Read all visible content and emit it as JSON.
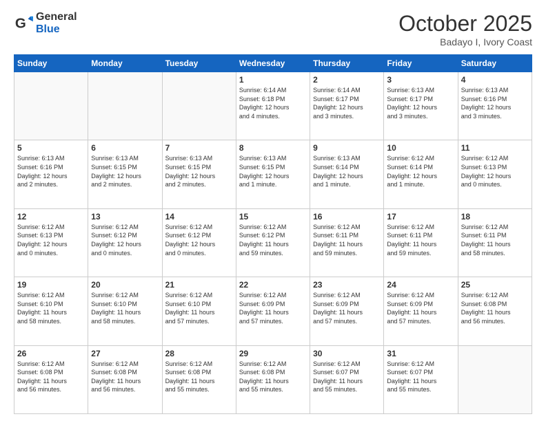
{
  "header": {
    "logo_line1": "General",
    "logo_line2": "Blue",
    "month": "October 2025",
    "location": "Badayo I, Ivory Coast"
  },
  "weekdays": [
    "Sunday",
    "Monday",
    "Tuesday",
    "Wednesday",
    "Thursday",
    "Friday",
    "Saturday"
  ],
  "weeks": [
    [
      {
        "day": "",
        "info": ""
      },
      {
        "day": "",
        "info": ""
      },
      {
        "day": "",
        "info": ""
      },
      {
        "day": "1",
        "info": "Sunrise: 6:14 AM\nSunset: 6:18 PM\nDaylight: 12 hours\nand 4 minutes."
      },
      {
        "day": "2",
        "info": "Sunrise: 6:14 AM\nSunset: 6:17 PM\nDaylight: 12 hours\nand 3 minutes."
      },
      {
        "day": "3",
        "info": "Sunrise: 6:13 AM\nSunset: 6:17 PM\nDaylight: 12 hours\nand 3 minutes."
      },
      {
        "day": "4",
        "info": "Sunrise: 6:13 AM\nSunset: 6:16 PM\nDaylight: 12 hours\nand 3 minutes."
      }
    ],
    [
      {
        "day": "5",
        "info": "Sunrise: 6:13 AM\nSunset: 6:16 PM\nDaylight: 12 hours\nand 2 minutes."
      },
      {
        "day": "6",
        "info": "Sunrise: 6:13 AM\nSunset: 6:15 PM\nDaylight: 12 hours\nand 2 minutes."
      },
      {
        "day": "7",
        "info": "Sunrise: 6:13 AM\nSunset: 6:15 PM\nDaylight: 12 hours\nand 2 minutes."
      },
      {
        "day": "8",
        "info": "Sunrise: 6:13 AM\nSunset: 6:15 PM\nDaylight: 12 hours\nand 1 minute."
      },
      {
        "day": "9",
        "info": "Sunrise: 6:13 AM\nSunset: 6:14 PM\nDaylight: 12 hours\nand 1 minute."
      },
      {
        "day": "10",
        "info": "Sunrise: 6:12 AM\nSunset: 6:14 PM\nDaylight: 12 hours\nand 1 minute."
      },
      {
        "day": "11",
        "info": "Sunrise: 6:12 AM\nSunset: 6:13 PM\nDaylight: 12 hours\nand 0 minutes."
      }
    ],
    [
      {
        "day": "12",
        "info": "Sunrise: 6:12 AM\nSunset: 6:13 PM\nDaylight: 12 hours\nand 0 minutes."
      },
      {
        "day": "13",
        "info": "Sunrise: 6:12 AM\nSunset: 6:12 PM\nDaylight: 12 hours\nand 0 minutes."
      },
      {
        "day": "14",
        "info": "Sunrise: 6:12 AM\nSunset: 6:12 PM\nDaylight: 12 hours\nand 0 minutes."
      },
      {
        "day": "15",
        "info": "Sunrise: 6:12 AM\nSunset: 6:12 PM\nDaylight: 11 hours\nand 59 minutes."
      },
      {
        "day": "16",
        "info": "Sunrise: 6:12 AM\nSunset: 6:11 PM\nDaylight: 11 hours\nand 59 minutes."
      },
      {
        "day": "17",
        "info": "Sunrise: 6:12 AM\nSunset: 6:11 PM\nDaylight: 11 hours\nand 59 minutes."
      },
      {
        "day": "18",
        "info": "Sunrise: 6:12 AM\nSunset: 6:11 PM\nDaylight: 11 hours\nand 58 minutes."
      }
    ],
    [
      {
        "day": "19",
        "info": "Sunrise: 6:12 AM\nSunset: 6:10 PM\nDaylight: 11 hours\nand 58 minutes."
      },
      {
        "day": "20",
        "info": "Sunrise: 6:12 AM\nSunset: 6:10 PM\nDaylight: 11 hours\nand 58 minutes."
      },
      {
        "day": "21",
        "info": "Sunrise: 6:12 AM\nSunset: 6:10 PM\nDaylight: 11 hours\nand 57 minutes."
      },
      {
        "day": "22",
        "info": "Sunrise: 6:12 AM\nSunset: 6:09 PM\nDaylight: 11 hours\nand 57 minutes."
      },
      {
        "day": "23",
        "info": "Sunrise: 6:12 AM\nSunset: 6:09 PM\nDaylight: 11 hours\nand 57 minutes."
      },
      {
        "day": "24",
        "info": "Sunrise: 6:12 AM\nSunset: 6:09 PM\nDaylight: 11 hours\nand 57 minutes."
      },
      {
        "day": "25",
        "info": "Sunrise: 6:12 AM\nSunset: 6:08 PM\nDaylight: 11 hours\nand 56 minutes."
      }
    ],
    [
      {
        "day": "26",
        "info": "Sunrise: 6:12 AM\nSunset: 6:08 PM\nDaylight: 11 hours\nand 56 minutes."
      },
      {
        "day": "27",
        "info": "Sunrise: 6:12 AM\nSunset: 6:08 PM\nDaylight: 11 hours\nand 56 minutes."
      },
      {
        "day": "28",
        "info": "Sunrise: 6:12 AM\nSunset: 6:08 PM\nDaylight: 11 hours\nand 55 minutes."
      },
      {
        "day": "29",
        "info": "Sunrise: 6:12 AM\nSunset: 6:08 PM\nDaylight: 11 hours\nand 55 minutes."
      },
      {
        "day": "30",
        "info": "Sunrise: 6:12 AM\nSunset: 6:07 PM\nDaylight: 11 hours\nand 55 minutes."
      },
      {
        "day": "31",
        "info": "Sunrise: 6:12 AM\nSunset: 6:07 PM\nDaylight: 11 hours\nand 55 minutes."
      },
      {
        "day": "",
        "info": ""
      }
    ]
  ]
}
